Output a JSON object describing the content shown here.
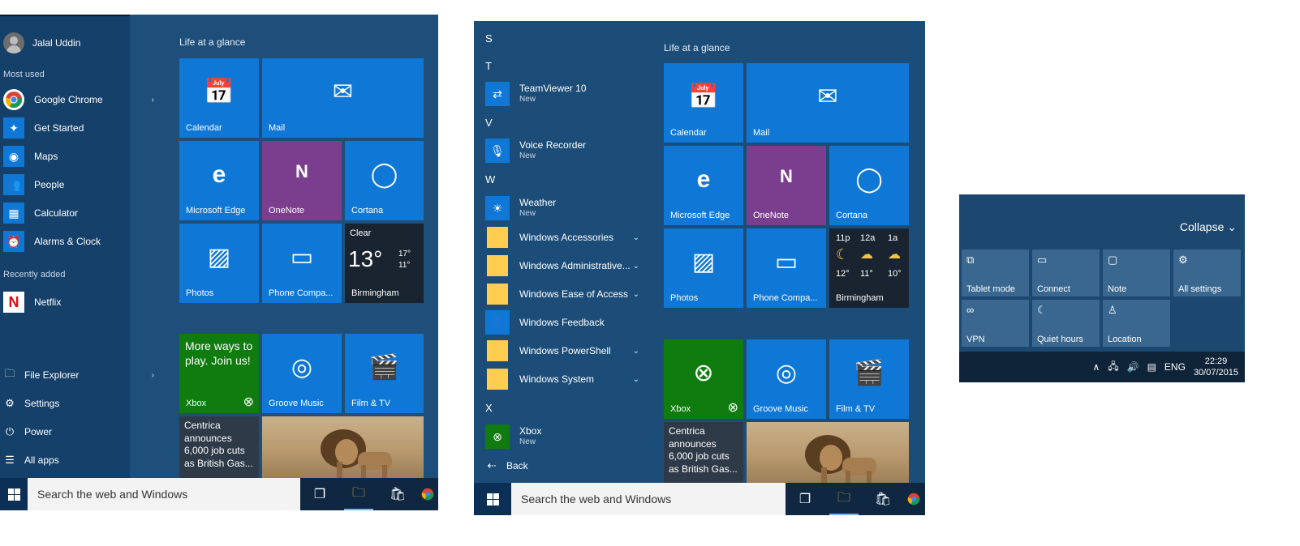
{
  "colors": {
    "tile_blue": "#0f78d7",
    "onenote_purple": "#7b3e8e",
    "xbox_green": "#107c10",
    "start_bg": "#1d4f7a",
    "action_center_bg": "#1c4870"
  },
  "panel1": {
    "user_name": "Jalal Uddin",
    "most_used_label": "Most used",
    "most_used": [
      {
        "label": "Google Chrome",
        "icon": "chrome-icon"
      },
      {
        "label": "Get Started",
        "icon": "lightbulb-icon"
      },
      {
        "label": "Maps",
        "icon": "maps-icon"
      },
      {
        "label": "People",
        "icon": "people-icon"
      },
      {
        "label": "Calculator",
        "icon": "calculator-icon"
      },
      {
        "label": "Alarms & Clock",
        "icon": "alarm-icon"
      }
    ],
    "recently_added_label": "Recently added",
    "recent": [
      {
        "label": "Netflix",
        "icon": "netflix-icon"
      }
    ],
    "bottom": [
      {
        "label": "File Explorer",
        "icon": "file-explorer-icon"
      },
      {
        "label": "Settings",
        "icon": "gear-icon"
      },
      {
        "label": "Power",
        "icon": "power-icon"
      },
      {
        "label": "All apps",
        "icon": "all-apps-icon"
      }
    ],
    "group1_title": "Life at a glance",
    "group2_title": "",
    "tiles": {
      "calendar": "Calendar",
      "mail": "Mail",
      "edge": "Microsoft Edge",
      "onenote": "OneNote",
      "cortana": "Cortana",
      "photos": "Photos",
      "phone": "Phone Compa...",
      "weather_cond": "Clear",
      "weather_temp": "13°",
      "weather_hi": "17°",
      "weather_lo": "11°",
      "weather_city": "Birmingham",
      "xbox_promo": "More ways to play. Join us!",
      "xbox": "Xbox",
      "groove": "Groove Music",
      "films": "Film & TV",
      "news": "Centrica announces 6,000 job cuts as British Gas..."
    },
    "search_placeholder": "Search the web and Windows"
  },
  "panel2": {
    "letters": [
      "S",
      "T",
      "V",
      "W",
      "X"
    ],
    "apps": [
      {
        "label": "TeamViewer 10",
        "sub": "New",
        "icon": "teamviewer-icon"
      },
      {
        "label": "Voice Recorder",
        "sub": "New",
        "icon": "microphone-icon"
      },
      {
        "label": "Weather",
        "sub": "New",
        "icon": "weather-icon"
      },
      {
        "label": "Windows Accessories",
        "icon": "folder-icon"
      },
      {
        "label": "Windows Administrative...",
        "icon": "folder-icon"
      },
      {
        "label": "Windows Ease of Access",
        "icon": "folder-icon"
      },
      {
        "label": "Windows Feedback",
        "icon": "feedback-icon"
      },
      {
        "label": "Windows PowerShell",
        "icon": "folder-icon"
      },
      {
        "label": "Windows System",
        "icon": "folder-icon"
      },
      {
        "label": "Xbox",
        "sub": "New",
        "icon": "xbox-icon"
      }
    ],
    "back_label": "Back",
    "group1_title": "Life at a glance",
    "tiles": {
      "calendar": "Calendar",
      "mail": "Mail",
      "edge": "Microsoft Edge",
      "onenote": "OneNote",
      "cortana": "Cortana",
      "photos": "Photos",
      "phone": "Phone Compa...",
      "hours": [
        "11p",
        "12a",
        "1a"
      ],
      "temps": [
        "12°",
        "11°",
        "10°"
      ],
      "weather_city": "Birmingham",
      "xbox": "Xbox",
      "groove": "Groove Music",
      "films": "Film & TV",
      "news": "Centrica announces 6,000 job cuts as British Gas..."
    },
    "search_placeholder": "Search the web and Windows"
  },
  "panel3": {
    "collapse_label": "Collapse",
    "actions": [
      {
        "label": "Tablet mode",
        "icon": "tablet-icon"
      },
      {
        "label": "Connect",
        "icon": "connect-icon"
      },
      {
        "label": "Note",
        "icon": "note-icon"
      },
      {
        "label": "All settings",
        "icon": "gear-icon"
      },
      {
        "label": "VPN",
        "icon": "vpn-icon"
      },
      {
        "label": "Quiet hours",
        "icon": "moon-icon"
      },
      {
        "label": "Location",
        "icon": "location-icon"
      }
    ],
    "language": "ENG",
    "time": "22:29",
    "date": "30/07/2015"
  }
}
